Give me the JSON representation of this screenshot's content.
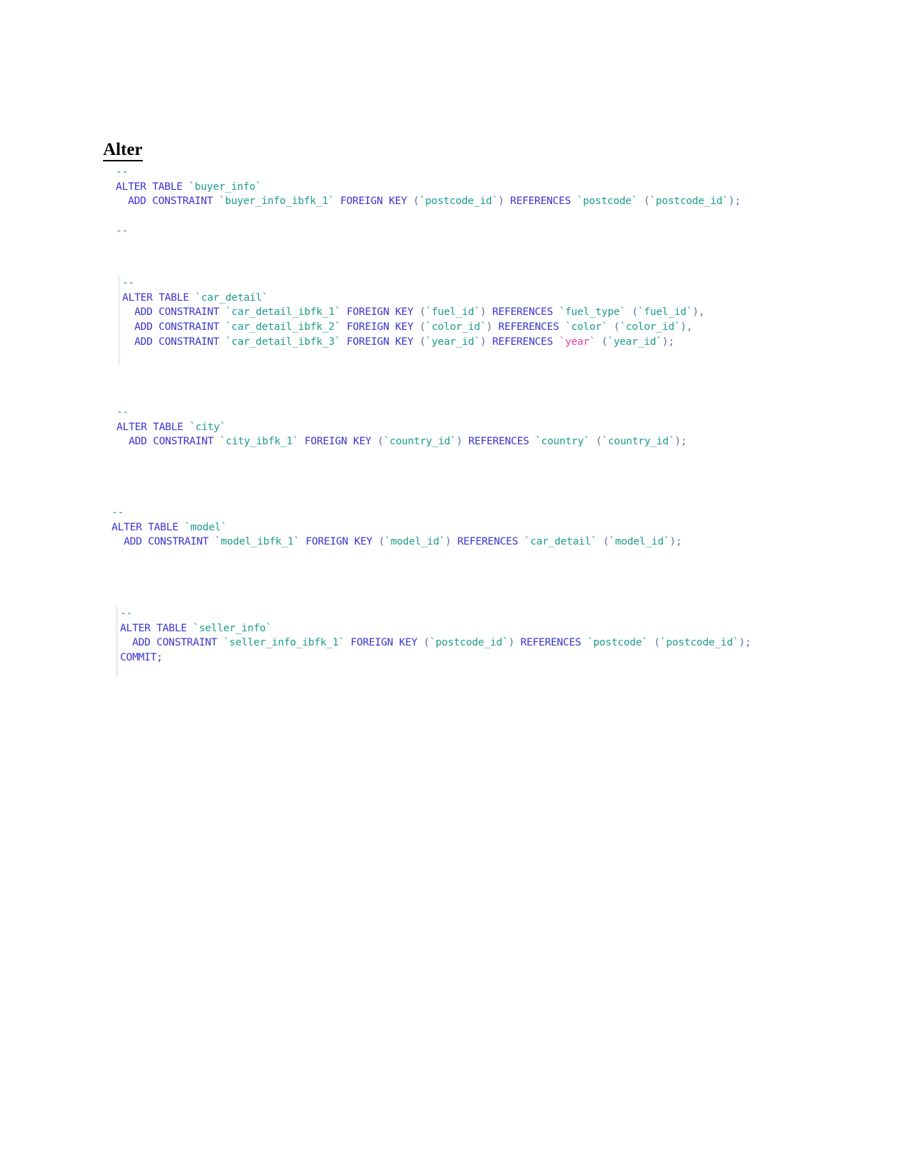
{
  "document": {
    "heading": "Alter ",
    "colors": {
      "comment": "#2d8a6e",
      "keyword": "#3a34d1",
      "identifier": "#1c9c8c",
      "punctuation": "#5a6fa8",
      "reserved_word": "#ea3fa0",
      "text": "#000000",
      "background": "#ffffff",
      "paste_bar": "#eceef2"
    }
  },
  "code_blocks": [
    {
      "name": "alter-buyer-info",
      "table": "buyer_info",
      "lines": [
        {
          "comment": "--"
        },
        {
          "kw1": "ALTER TABLE ",
          "ident": "`buyer_info`"
        },
        {
          "indent": "  ",
          "kw1": "ADD CONSTRAINT ",
          "name": "`buyer_info_ibfk_1`",
          "kw2": " FOREIGN KEY ",
          "punc1": "(",
          "col": "`postcode_id`",
          "punc2": ") ",
          "kw3": "REFERENCES ",
          "reftable": "`postcode`",
          "punc3": " (",
          "refcol": "`postcode_id`",
          "punc4": ");"
        },
        {
          "blank": ""
        },
        {
          "comment": "--"
        }
      ]
    },
    {
      "name": "alter-car-detail",
      "table": "car_detail",
      "lines": [
        {
          "comment": "--"
        },
        {
          "kw1": "ALTER TABLE ",
          "ident": "`car_detail`"
        },
        {
          "indent": "  ",
          "kw1": "ADD CONSTRAINT ",
          "name": "`car_detail_ibfk_1`",
          "kw2": " FOREIGN KEY ",
          "punc1": "(",
          "col": "`fuel_id`",
          "punc2": ") ",
          "kw3": "REFERENCES ",
          "reftable": "`fuel_type`",
          "punc3": " (",
          "refcol": "`fuel_id`",
          "punc4": "),"
        },
        {
          "indent": "  ",
          "kw1": "ADD CONSTRAINT ",
          "name": "`car_detail_ibfk_2`",
          "kw2": " FOREIGN KEY ",
          "punc1": "(",
          "col": "`color_id`",
          "punc2": ") ",
          "kw3": "REFERENCES ",
          "reftable": "`color`",
          "punc3": " (",
          "refcol": "`color_id`",
          "punc4": "),"
        },
        {
          "indent": "  ",
          "kw1": "ADD CONSTRAINT ",
          "name": "`car_detail_ibfk_3`",
          "kw2": " FOREIGN KEY ",
          "punc1": "(",
          "col": "`year_id`",
          "punc2": ") ",
          "kw3": "REFERENCES ",
          "reftable_reserved": "`year`",
          "punc3": " (",
          "refcol": "`year_id`",
          "punc4": ");"
        }
      ]
    },
    {
      "name": "alter-city",
      "table": "city",
      "lines": [
        {
          "comment": "--"
        },
        {
          "kw1": "ALTER TABLE ",
          "ident": "`city`"
        },
        {
          "indent": "  ",
          "kw1": "ADD CONSTRAINT ",
          "name": "`city_ibfk_1`",
          "kw2": " FOREIGN KEY ",
          "punc1": "(",
          "col": "`country_id`",
          "punc2": ") ",
          "kw3": "REFERENCES ",
          "reftable": "`country`",
          "punc3": " (",
          "refcol": "`country_id`",
          "punc4": ");"
        }
      ]
    },
    {
      "name": "alter-model",
      "table": "model",
      "lines": [
        {
          "comment": "--"
        },
        {
          "kw1": "ALTER TABLE ",
          "ident": "`model`"
        },
        {
          "indent": "  ",
          "kw1": "ADD CONSTRAINT ",
          "name": "`model_ibfk_1`",
          "kw2": " FOREIGN KEY ",
          "punc1": "(",
          "col": "`model_id`",
          "punc2": ") ",
          "kw3": "REFERENCES ",
          "reftable": "`car_detail`",
          "punc3": " (",
          "refcol": "`model_id`",
          "punc4": ");"
        }
      ]
    },
    {
      "name": "alter-seller-info",
      "table": "seller_info",
      "lines": [
        {
          "comment": "--"
        },
        {
          "kw1": "ALTER TABLE ",
          "ident": "`seller_info`"
        },
        {
          "indent": "  ",
          "kw1": "ADD CONSTRAINT ",
          "name": "`seller_info_ibfk_1`",
          "kw2": " FOREIGN KEY ",
          "punc1": "(",
          "col": "`postcode_id`",
          "punc2": ") ",
          "kw3": "REFERENCES ",
          "reftable": "`postcode`",
          "punc3": " (",
          "refcol": "`postcode_id`",
          "punc4": ");"
        },
        {
          "commit": "COMMIT;"
        }
      ]
    }
  ]
}
